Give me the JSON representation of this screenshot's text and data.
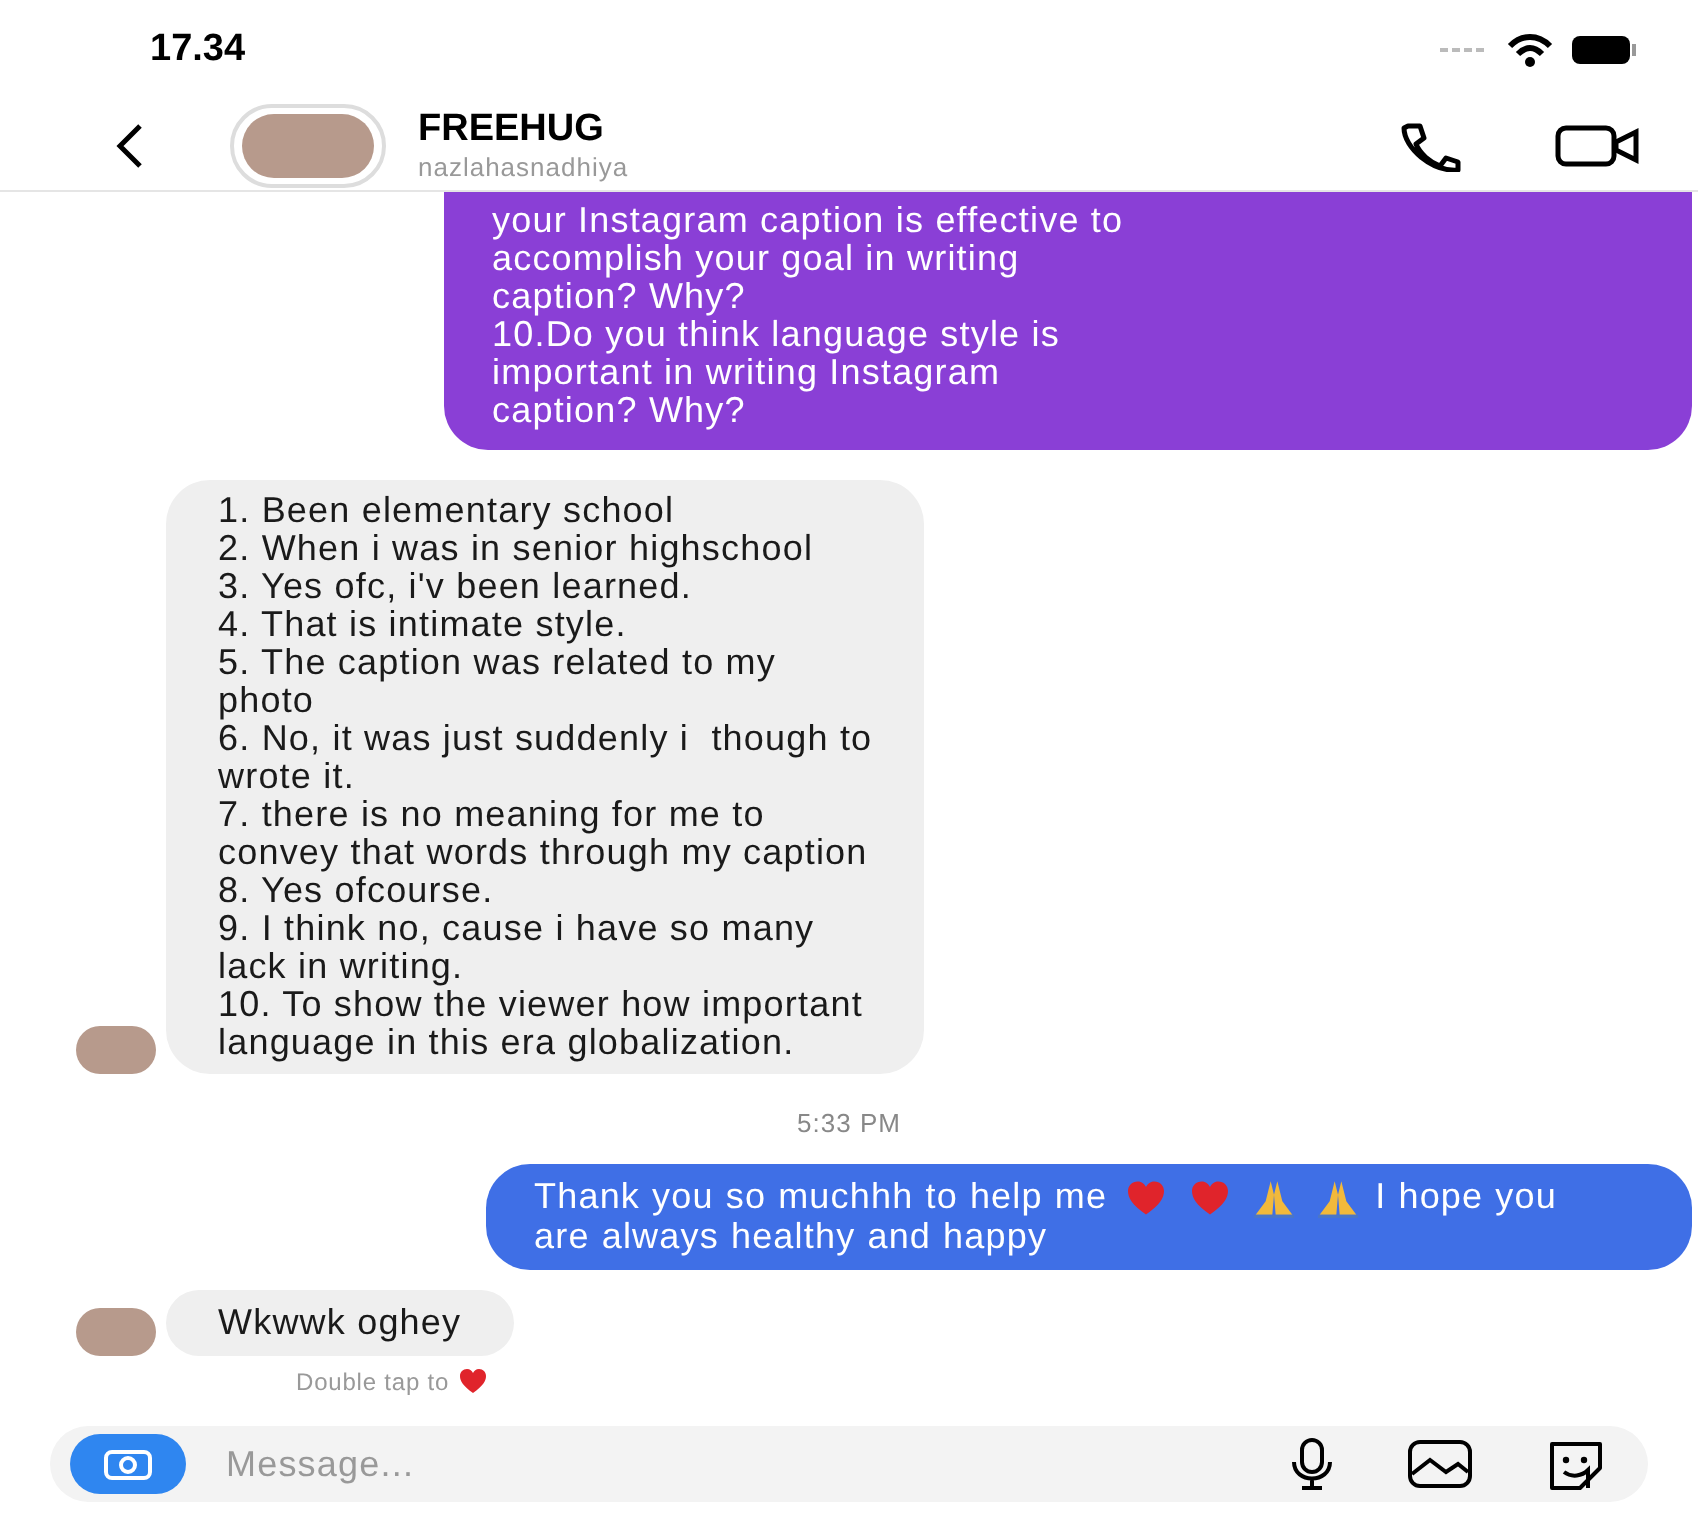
{
  "status_bar": {
    "time": "17.34"
  },
  "header": {
    "title": "FREEHUG",
    "username": "nazlahasnadhiya"
  },
  "messages": [
    {
      "kind": "sent",
      "color": "#8a3fd6",
      "lines": [
        "your Instagram caption is effective to",
        "accomplish your goal in writing",
        "caption? Why?",
        "10.Do you think language style is",
        "important in writing Instagram",
        "caption? Why?"
      ]
    },
    {
      "kind": "received",
      "avatar": true,
      "lines": [
        "1. Been elementary school",
        "2. When i was in senior highschool",
        "3. Yes ofc, i'v been learned.",
        "4. That is intimate style.",
        "5. The caption was related to my",
        "photo",
        "6. No, it was just suddenly i  though to",
        "wrote it.",
        "7. there is no meaning for me to",
        "convey that words through my caption",
        "8. Yes ofcourse.",
        "9. I think no, cause i have so many",
        "lack in writing.",
        "10. To show the viewer how important",
        "language in this era globalization."
      ]
    },
    {
      "kind": "time",
      "text": "5:33 PM"
    },
    {
      "kind": "sent",
      "color": "#3f6fe6",
      "parts": [
        {
          "kind": "text",
          "text": "Thank you so muchhh to help me"
        },
        {
          "kind": "heart"
        },
        {
          "kind": "heart"
        },
        {
          "kind": "pray"
        },
        {
          "kind": "pray"
        },
        {
          "kind": "text",
          "text": "I hope you are always healthy and happy"
        }
      ]
    },
    {
      "kind": "received",
      "avatar": true,
      "lines": [
        "Wkwwk oghey"
      ]
    },
    {
      "kind": "hint",
      "text": "Double tap to"
    }
  ],
  "composer": {
    "placeholder": "Message..."
  }
}
